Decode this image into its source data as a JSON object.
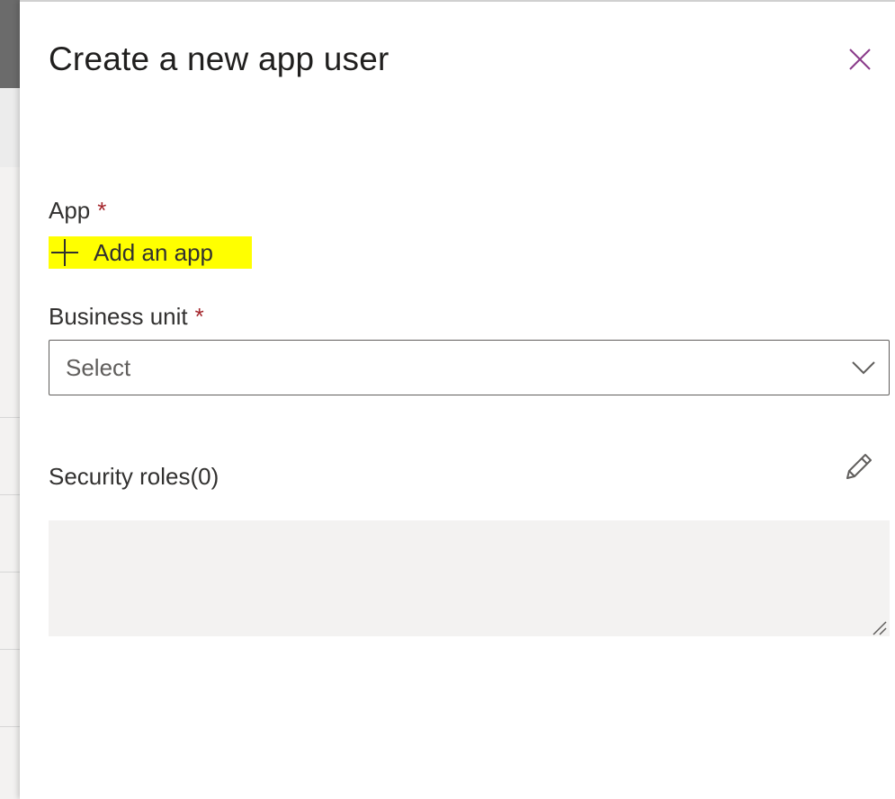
{
  "panel": {
    "title": "Create a new app user"
  },
  "form": {
    "app": {
      "label": "App",
      "required_marker": "*",
      "add_link_label": "Add an app"
    },
    "business_unit": {
      "label": "Business unit",
      "required_marker": "*",
      "selected_value": "Select"
    },
    "security_roles": {
      "label": "Security roles(0)"
    }
  },
  "icons": {
    "close": "close-icon",
    "add": "plus-icon",
    "dropdown": "chevron-down-icon",
    "edit": "pencil-icon",
    "resize": "resize-grip-icon"
  },
  "colors": {
    "close_icon": "#8a3a8a",
    "required": "#a4262c",
    "highlight": "#ffff00",
    "roles_box_bg": "#f3f2f1"
  }
}
